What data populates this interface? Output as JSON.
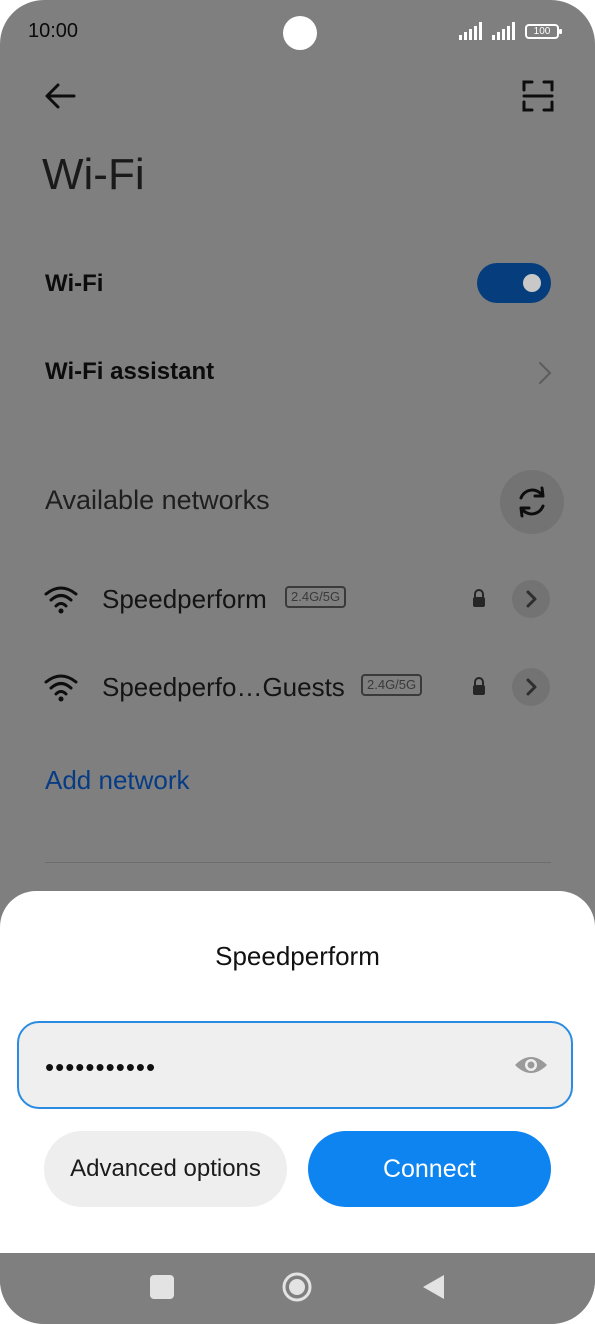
{
  "status_bar": {
    "time": "10:00",
    "battery": "100"
  },
  "header": {
    "title": "Wi-Fi"
  },
  "settings": {
    "wifi_label": "Wi-Fi",
    "wifi_enabled": true,
    "assistant_label": "Wi-Fi assistant"
  },
  "networks": {
    "section_title": "Available networks",
    "items": [
      {
        "name": "Speedperform",
        "band": "2.4G/5G",
        "secured": true
      },
      {
        "name": "Speedperfo…Guests",
        "band": "2.4G/5G",
        "secured": true
      }
    ],
    "add_label": "Add network"
  },
  "dialog": {
    "title": "Speedperform",
    "password_value": "•••••••••••",
    "advanced_label": "Advanced options",
    "connect_label": "Connect"
  },
  "icons": {
    "back": "arrow-left-icon",
    "scan": "qr-scan-icon",
    "refresh": "refresh-icon",
    "wifi": "wifi-icon",
    "lock": "lock-icon",
    "chevron": "chevron-right-icon",
    "eye": "eye-icon"
  },
  "colors": {
    "accent": "#0d84f0",
    "link": "#073c84",
    "toggle_on": "#063e7d",
    "scrim": "#7f7f7f"
  }
}
